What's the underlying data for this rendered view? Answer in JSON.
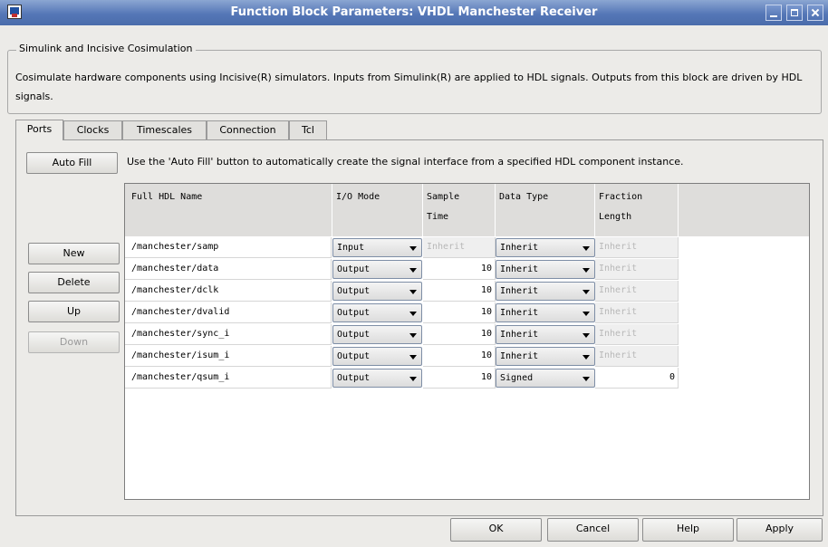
{
  "window": {
    "title": "Function Block Parameters: VHDL Manchester Receiver",
    "controls": [
      "minimize-icon",
      "maximize-icon",
      "close-icon"
    ]
  },
  "group": {
    "title": "Simulink and Incisive Cosimulation",
    "description": "Cosimulate hardware components using Incisive(R) simulators.  Inputs from Simulink(R) are applied to HDL signals.  Outputs from this block are driven by HDL signals."
  },
  "tabs": [
    {
      "label": "Ports",
      "active": true
    },
    {
      "label": "Clocks",
      "active": false
    },
    {
      "label": "Timescales",
      "active": false
    },
    {
      "label": "Connection",
      "active": false
    },
    {
      "label": "Tcl",
      "active": false
    }
  ],
  "ports": {
    "auto_fill_label": "Auto Fill",
    "hint": "Use the 'Auto Fill' button to automatically create the signal interface from a specified HDL component instance.",
    "side_buttons": {
      "new": "New",
      "delete": "Delete",
      "up": "Up",
      "down": "Down"
    },
    "columns": {
      "name": "Full HDL Name",
      "mode": "I/O Mode",
      "sample_line1": "Sample",
      "sample_line2": "Time",
      "dtype": "Data Type",
      "frac_line1": "Fraction",
      "frac_line2": "Length"
    },
    "rows": [
      {
        "name": "/manchester/samp",
        "mode": "Input",
        "sample_time": "Inherit",
        "data_type": "Inherit",
        "fraction": "Inherit"
      },
      {
        "name": "/manchester/data",
        "mode": "Output",
        "sample_time": "10",
        "data_type": "Inherit",
        "fraction": "Inherit"
      },
      {
        "name": "/manchester/dclk",
        "mode": "Output",
        "sample_time": "10",
        "data_type": "Inherit",
        "fraction": "Inherit"
      },
      {
        "name": "/manchester/dvalid",
        "mode": "Output",
        "sample_time": "10",
        "data_type": "Inherit",
        "fraction": "Inherit"
      },
      {
        "name": "/manchester/sync_i",
        "mode": "Output",
        "sample_time": "10",
        "data_type": "Inherit",
        "fraction": "Inherit"
      },
      {
        "name": "/manchester/isum_i",
        "mode": "Output",
        "sample_time": "10",
        "data_type": "Inherit",
        "fraction": "Inherit"
      },
      {
        "name": "/manchester/qsum_i",
        "mode": "Output",
        "sample_time": "10",
        "data_type": "Signed",
        "fraction": "0"
      }
    ]
  },
  "footer": {
    "ok": "OK",
    "cancel": "Cancel",
    "help": "Help",
    "apply": "Apply"
  },
  "colors": {
    "titlebar": "#5577b7",
    "window_bg": "#ecebe8",
    "disabled_text": "#b8b8b8"
  }
}
